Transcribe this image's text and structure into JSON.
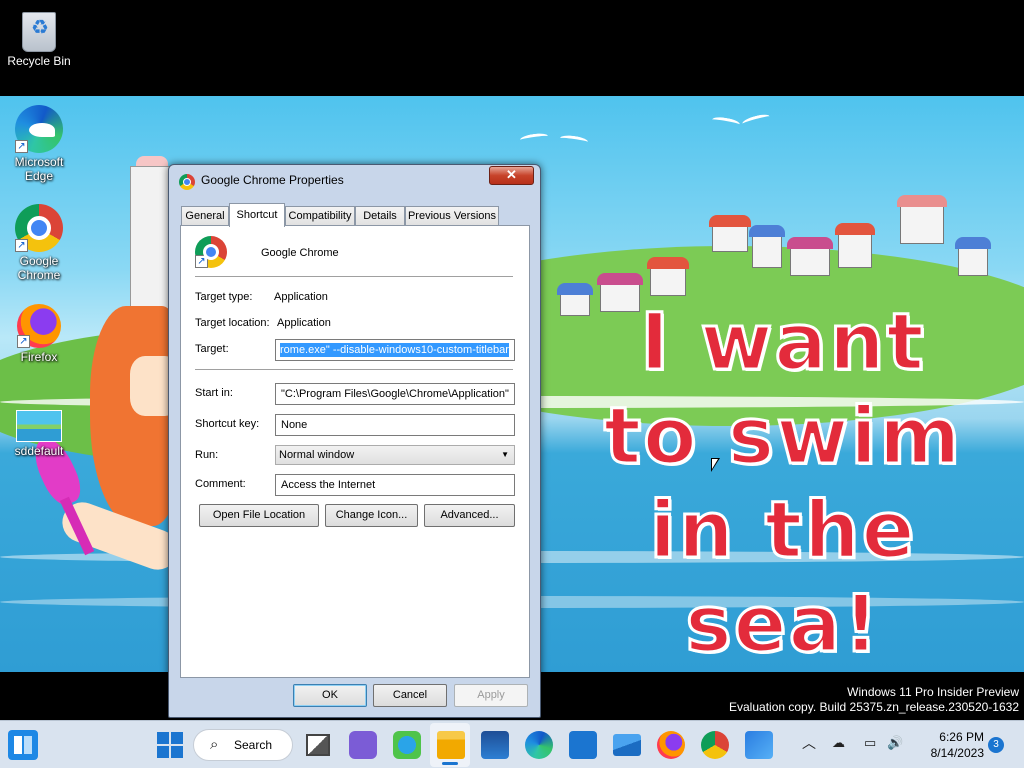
{
  "desktop": {
    "icons": [
      {
        "label": "Recycle Bin",
        "icon": "recycle-bin-icon"
      },
      {
        "label": "Microsoft Edge",
        "icon": "edge-icon"
      },
      {
        "label": "Google Chrome",
        "icon": "chrome-icon"
      },
      {
        "label": "Firefox",
        "icon": "firefox-icon"
      },
      {
        "label": "sddefault",
        "icon": "image-thumbnail-icon"
      }
    ],
    "wallpaper_text": [
      "I want",
      "to swim",
      "in the sea!"
    ]
  },
  "dialog": {
    "title": "Google Chrome Properties",
    "close_glyph": "✕",
    "tabs": [
      "General",
      "Shortcut",
      "Compatibility",
      "Details",
      "Previous Versions"
    ],
    "active_tab": "Shortcut",
    "app_name": "Google Chrome",
    "target_type_label": "Target type:",
    "target_type_value": "Application",
    "target_location_label": "Target location:",
    "target_location_value": "Application",
    "target_label": "Target:",
    "target_value": "rome.exe\" --disable-windows10-custom-titlebar",
    "start_in_label": "Start in:",
    "start_in_value": "\"C:\\Program Files\\Google\\Chrome\\Application\"",
    "shortcut_key_label": "Shortcut key:",
    "shortcut_key_value": "None",
    "run_label": "Run:",
    "run_value": "Normal window",
    "comment_label": "Comment:",
    "comment_value": "Access the Internet",
    "buttons": {
      "open_file_location": "Open File Location",
      "change_icon": "Change Icon...",
      "advanced": "Advanced...",
      "ok": "OK",
      "cancel": "Cancel",
      "apply": "Apply"
    }
  },
  "watermark": {
    "line1": "Windows 11 Pro Insider Preview",
    "line2": "Evaluation copy. Build 25375.zn_release.230520-1632"
  },
  "taskbar": {
    "search_label": "Search",
    "time": "6:26 PM",
    "date": "8/14/2023",
    "notification_count": "3"
  },
  "colors": {
    "accent": "#1b75d0",
    "selection": "#3399ff",
    "close_button": "#c7432a",
    "slogan": "#e32b3b"
  }
}
